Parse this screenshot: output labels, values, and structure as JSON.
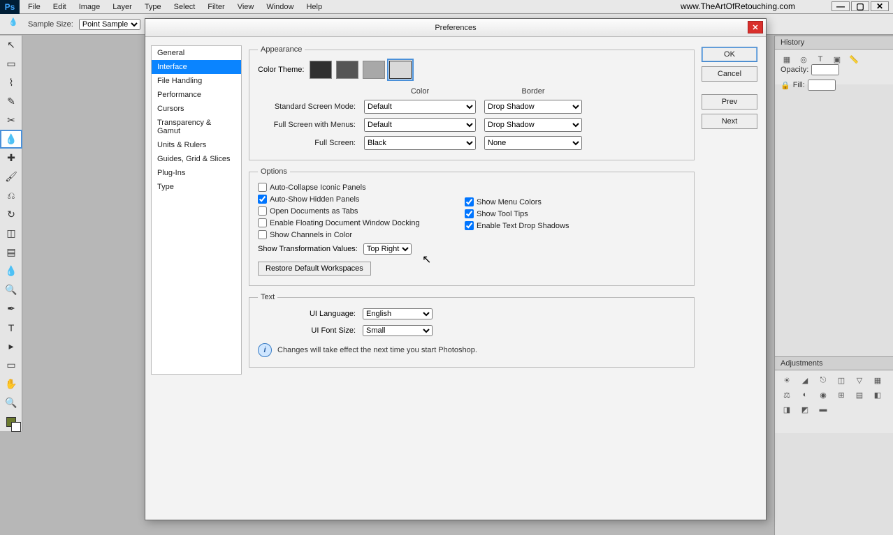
{
  "app": {
    "url": "www.TheArtOfRetouching.com"
  },
  "menubar": [
    "File",
    "Edit",
    "Image",
    "Layer",
    "Type",
    "Select",
    "Filter",
    "View",
    "Window",
    "Help"
  ],
  "options_bar": {
    "sample_size_label": "Sample Size:",
    "sample_size_value": "Point Sample"
  },
  "toolbox": [
    {
      "n": "move-tool",
      "g": "↖"
    },
    {
      "n": "marquee-tool",
      "g": "▭"
    },
    {
      "n": "lasso-tool",
      "g": "⌇"
    },
    {
      "n": "quick-select-tool",
      "g": "✎"
    },
    {
      "n": "crop-tool",
      "g": "✂"
    },
    {
      "n": "eyedropper-tool",
      "g": "💧",
      "sel": true
    },
    {
      "n": "spot-heal-tool",
      "g": "✚"
    },
    {
      "n": "brush-tool",
      "g": "🖌"
    },
    {
      "n": "stamp-tool",
      "g": "⎌"
    },
    {
      "n": "history-brush-tool",
      "g": "↻"
    },
    {
      "n": "eraser-tool",
      "g": "◫"
    },
    {
      "n": "gradient-tool",
      "g": "▤"
    },
    {
      "n": "blur-tool",
      "g": "💧"
    },
    {
      "n": "dodge-tool",
      "g": "🔍"
    },
    {
      "n": "pen-tool",
      "g": "✒"
    },
    {
      "n": "type-tool",
      "g": "T"
    },
    {
      "n": "path-select-tool",
      "g": "▸"
    },
    {
      "n": "rectangle-tool",
      "g": "▭"
    },
    {
      "n": "hand-tool",
      "g": "✋"
    },
    {
      "n": "zoom-tool",
      "g": "🔍"
    }
  ],
  "panels": {
    "history_tab": "History",
    "adjustments_tab": "Adjustments",
    "opacity_label": "Opacity:",
    "opacity_value": "",
    "fill_label": "Fill:",
    "fill_value": ""
  },
  "dialog": {
    "title": "Preferences",
    "categories": [
      "General",
      "Interface",
      "File Handling",
      "Performance",
      "Cursors",
      "Transparency & Gamut",
      "Units & Rulers",
      "Guides, Grid & Slices",
      "Plug-Ins",
      "Type"
    ],
    "selected_category": 1,
    "buttons": {
      "ok": "OK",
      "cancel": "Cancel",
      "prev": "Prev",
      "next": "Next"
    },
    "appearance": {
      "legend": "Appearance",
      "color_theme_label": "Color Theme:",
      "themes": [
        "#303030",
        "#555555",
        "#a8a8a8",
        "#d9d9d9"
      ],
      "selected_theme": 3,
      "color_header": "Color",
      "border_header": "Border",
      "rows": [
        {
          "label": "Standard Screen Mode:",
          "color": "Default",
          "border": "Drop Shadow"
        },
        {
          "label": "Full Screen with Menus:",
          "color": "Default",
          "border": "Drop Shadow"
        },
        {
          "label": "Full Screen:",
          "color": "Black",
          "border": "None"
        }
      ]
    },
    "options": {
      "legend": "Options",
      "left": [
        {
          "label": "Auto-Collapse Iconic Panels",
          "checked": false
        },
        {
          "label": "Auto-Show Hidden Panels",
          "checked": true
        },
        {
          "label": "Open Documents as Tabs",
          "checked": false
        },
        {
          "label": "Enable Floating Document Window Docking",
          "checked": false
        },
        {
          "label": "Show Channels in Color",
          "checked": false
        }
      ],
      "right": [
        {
          "label": "Show Menu Colors",
          "checked": true
        },
        {
          "label": "Show Tool Tips",
          "checked": true
        },
        {
          "label": "Enable Text Drop Shadows",
          "checked": true
        }
      ],
      "transform_label": "Show Transformation Values:",
      "transform_value": "Top Right",
      "restore_btn": "Restore Default Workspaces"
    },
    "text": {
      "legend": "Text",
      "lang_label": "UI Language:",
      "lang_value": "English",
      "size_label": "UI Font Size:",
      "size_value": "Small",
      "info": "Changes will take effect the next time you start Photoshop."
    }
  }
}
